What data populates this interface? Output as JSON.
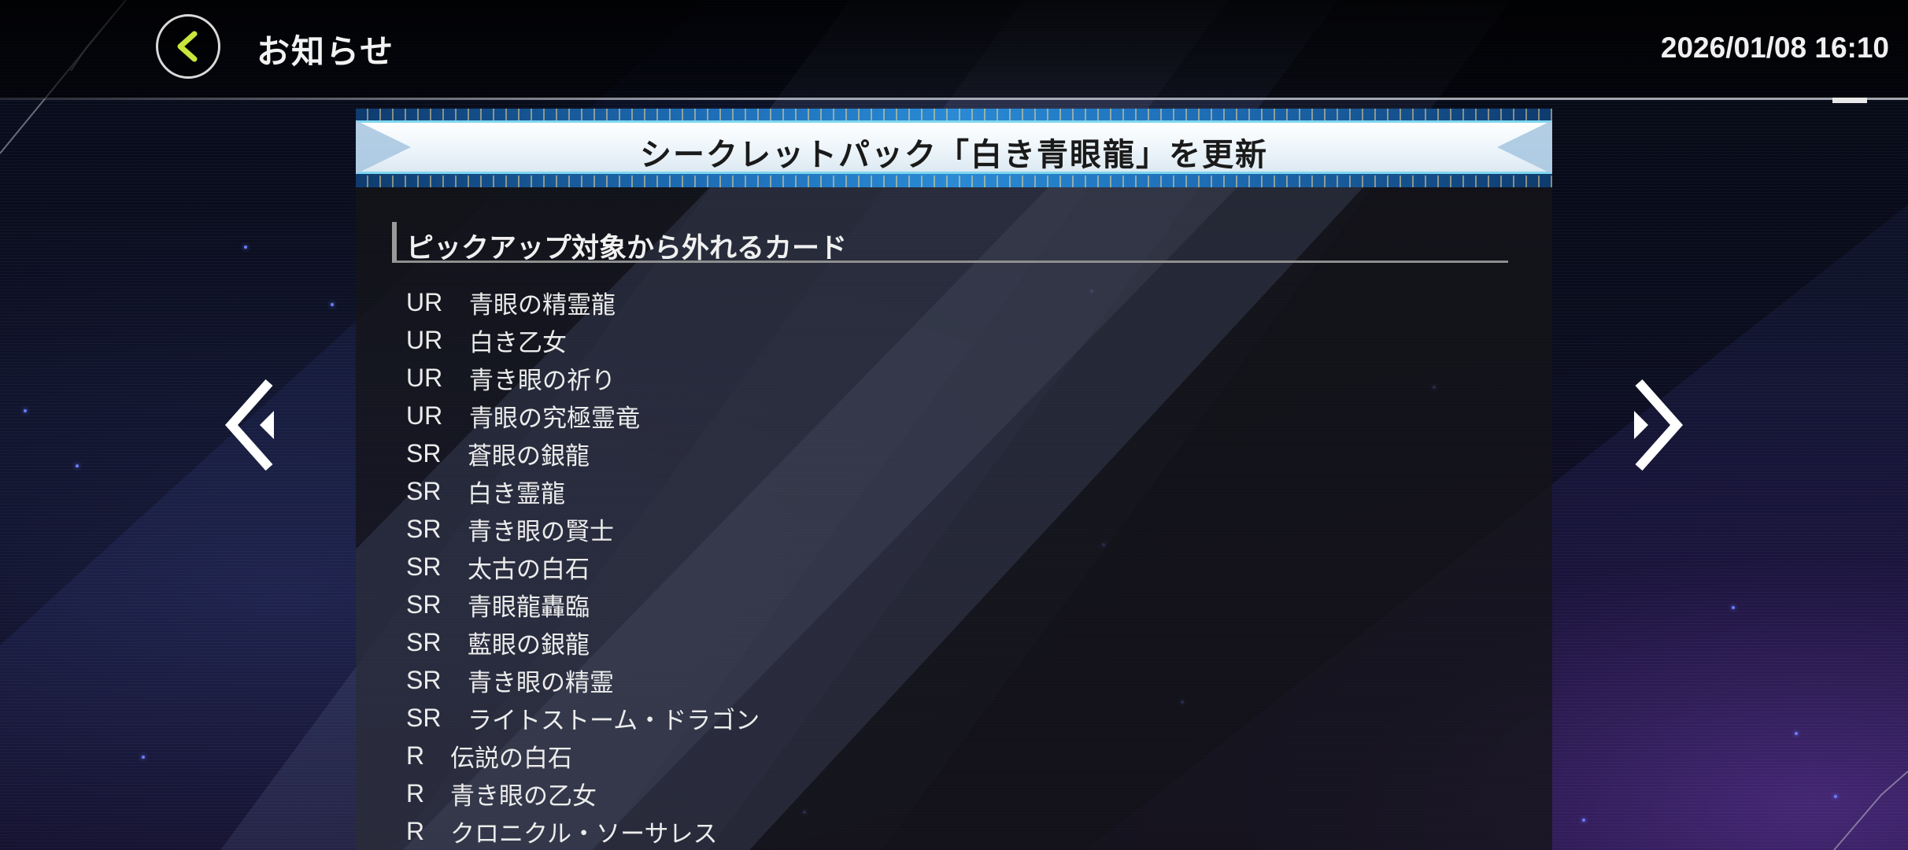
{
  "header": {
    "title": "お知らせ",
    "datetime": "2026/01/08 16:10",
    "back_icon": "chevron-left-icon",
    "accent_color": "#c8e63c"
  },
  "notice": {
    "title": "シークレットパック「白き青眼龍」を更新",
    "section_heading": "ピックアップ対象から外れるカード",
    "cards": [
      {
        "rarity": "UR",
        "name": "青眼の精霊龍"
      },
      {
        "rarity": "UR",
        "name": "白き乙女"
      },
      {
        "rarity": "UR",
        "name": "青き眼の祈り"
      },
      {
        "rarity": "UR",
        "name": "青眼の究極霊竜"
      },
      {
        "rarity": "SR",
        "name": "蒼眼の銀龍"
      },
      {
        "rarity": "SR",
        "name": "白き霊龍"
      },
      {
        "rarity": "SR",
        "name": "青き眼の賢士"
      },
      {
        "rarity": "SR",
        "name": "太古の白石"
      },
      {
        "rarity": "SR",
        "name": "青眼龍轟臨"
      },
      {
        "rarity": "SR",
        "name": "藍眼の銀龍"
      },
      {
        "rarity": "SR",
        "name": "青き眼の精霊"
      },
      {
        "rarity": "SR",
        "name": "ライトストーム・ドラゴン"
      },
      {
        "rarity": "R",
        "name": "伝説の白石"
      },
      {
        "rarity": "R",
        "name": "青き眼の乙女"
      },
      {
        "rarity": "R",
        "name": "クロニクル・ソーサレス"
      }
    ]
  },
  "navigation": {
    "prev_icon": "double-chevron-left-icon",
    "next_icon": "double-chevron-right-icon"
  }
}
